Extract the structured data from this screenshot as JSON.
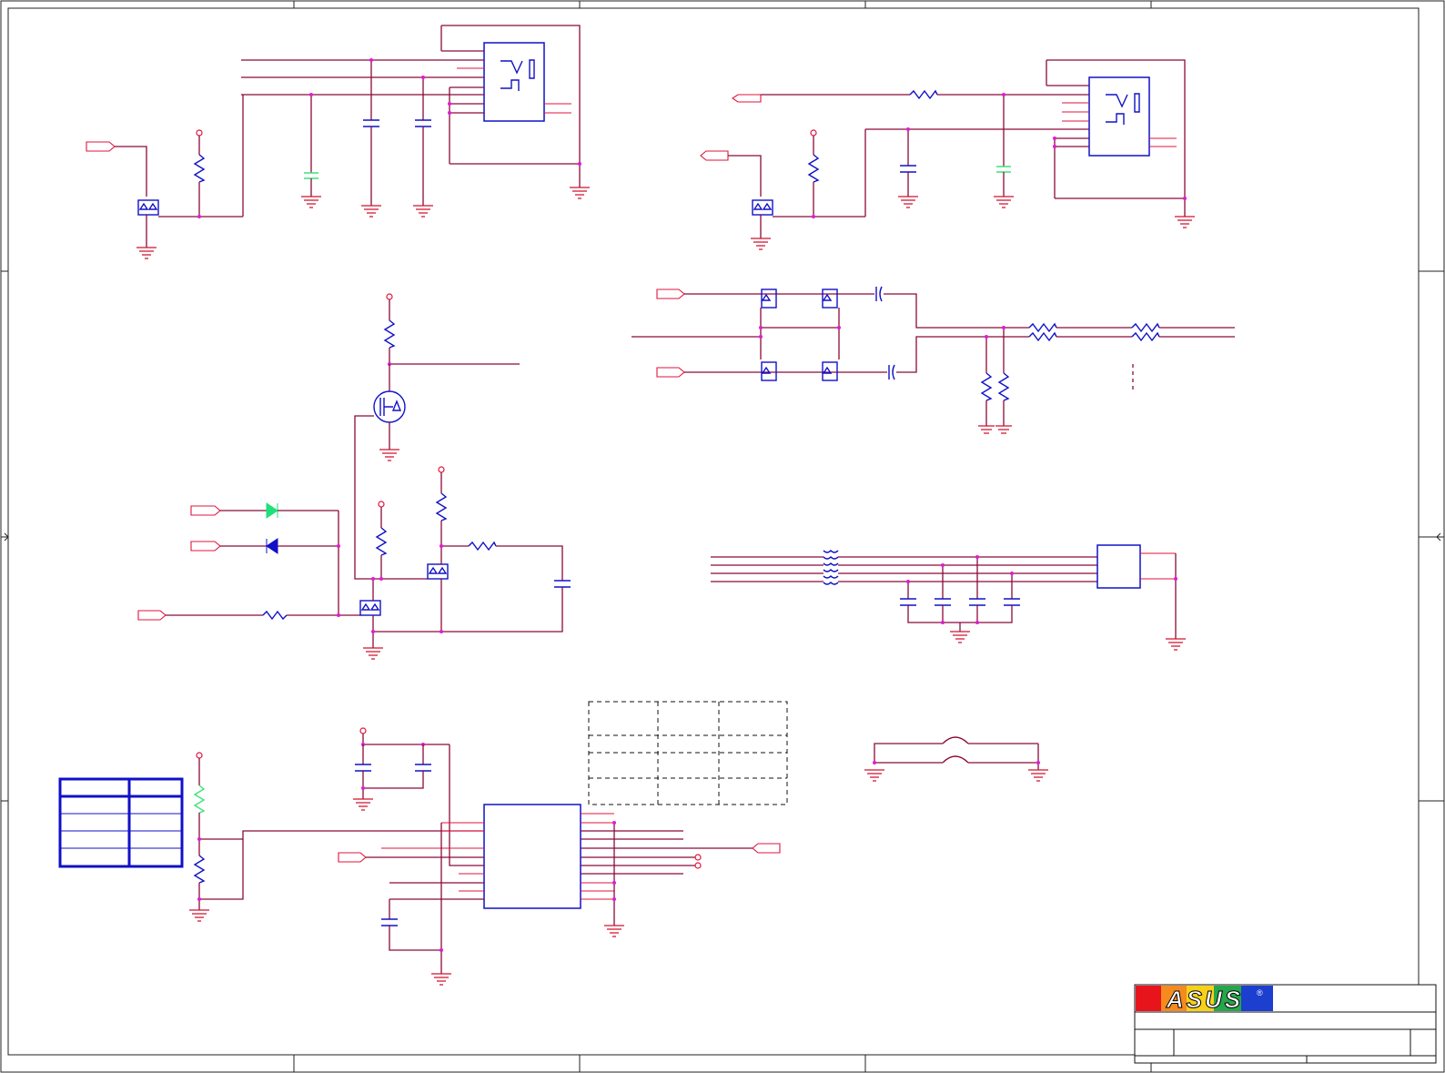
{
  "title_block": {
    "logo_text": "ASUS",
    "logo_colors": [
      "#e8141c",
      "#f58a1f",
      "#f7d117",
      "#25a74a",
      "#1c3fd0"
    ],
    "registered_mark": "®"
  },
  "colors": {
    "wire": "#8b0a3a",
    "pin": "#e0143c",
    "component": "#1010c8",
    "junction": "#e01bd6",
    "capacitor_alt": "#3ee27a"
  },
  "icons": [
    "resistor-icon",
    "capacitor-icon",
    "mosfet-icon",
    "diode-icon",
    "ground-icon",
    "connector-jack-icon",
    "ferrite-bead-icon"
  ]
}
